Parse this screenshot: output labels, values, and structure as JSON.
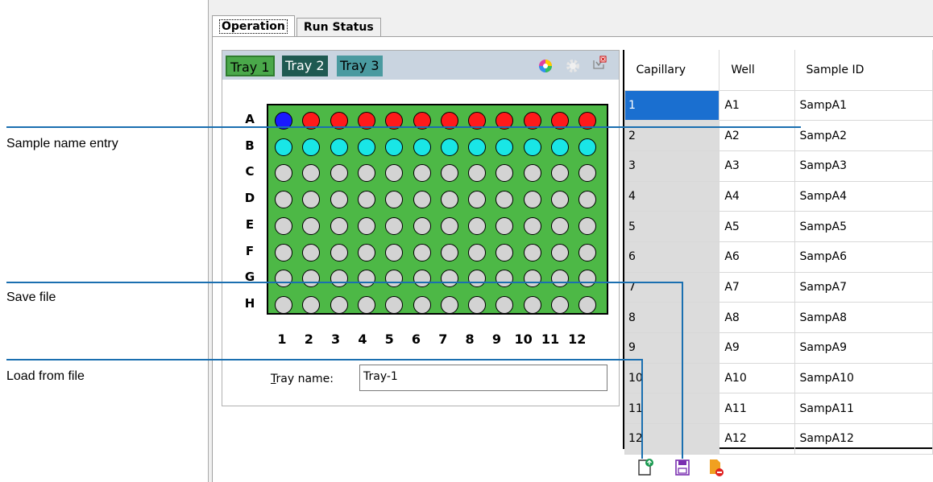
{
  "callouts": {
    "sample_name_entry": "Sample name entry",
    "save_file": "Save file",
    "load_from_file": "Load from file"
  },
  "tabs": [
    {
      "label": "Operation",
      "active": true
    },
    {
      "label": "Run Status",
      "active": false
    }
  ],
  "trays": [
    {
      "label": "Tray 1",
      "active": true
    },
    {
      "label": "Tray 2",
      "active": false
    },
    {
      "label": "Tray 3",
      "active": false
    }
  ],
  "header_icons": [
    "color-wheel-icon",
    "gear-icon",
    "export-icon"
  ],
  "plate": {
    "rows": [
      "A",
      "B",
      "C",
      "D",
      "E",
      "F",
      "G",
      "H"
    ],
    "columns": [
      "1",
      "2",
      "3",
      "4",
      "5",
      "6",
      "7",
      "8",
      "9",
      "10",
      "11",
      "12"
    ],
    "colors": {
      "plate": "#4db846",
      "empty": "#d3d3d3",
      "selected": "#1a1aff",
      "row_a": "#ff1a1a",
      "row_b": "#19e6e6"
    }
  },
  "tray_name": {
    "label_prefix": "T",
    "label_rest": "ray name:",
    "value": "Tray-1"
  },
  "table": {
    "headers": [
      "Capillary",
      "Well",
      "Sample ID"
    ],
    "rows": [
      [
        "1",
        "A1",
        "SampA1"
      ],
      [
        "2",
        "A2",
        "SampA2"
      ],
      [
        "3",
        "A3",
        "SampA3"
      ],
      [
        "4",
        "A4",
        "SampA4"
      ],
      [
        "5",
        "A5",
        "SampA5"
      ],
      [
        "6",
        "A6",
        "SampA6"
      ],
      [
        "7",
        "A7",
        "SampA7"
      ],
      [
        "8",
        "A8",
        "SampA8"
      ],
      [
        "9",
        "A9",
        "SampA9"
      ],
      [
        "10",
        "A10",
        "SampA10"
      ],
      [
        "11",
        "A11",
        "SampA11"
      ],
      [
        "12",
        "A12",
        "SampA12"
      ]
    ]
  },
  "bottom_icons": [
    "load-file-icon",
    "save-file-icon",
    "clear-file-icon"
  ]
}
